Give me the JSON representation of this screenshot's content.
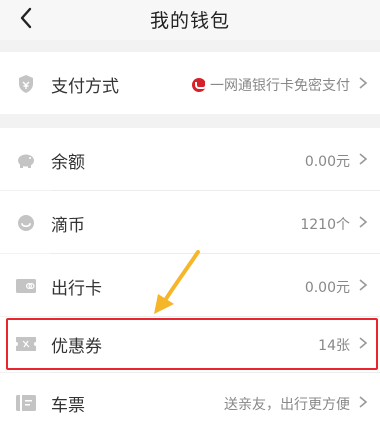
{
  "header": {
    "title": "我的钱包",
    "back_icon": "chevron-left-icon"
  },
  "rows": [
    {
      "icon": "shield-icon",
      "label": "支付方式",
      "value": "一网通银行卡免密支付",
      "badge": "cmb-logo-icon"
    },
    {
      "icon": "piggy-bank-icon",
      "label": "余额",
      "value": "0.00元"
    },
    {
      "icon": "coin-icon",
      "label": "滴币",
      "value": "1210个"
    },
    {
      "icon": "card-icon",
      "label": "出行卡",
      "value": "0.00元"
    },
    {
      "icon": "coupon-icon",
      "label": "优惠券",
      "value": "14张"
    },
    {
      "icon": "ticket-icon",
      "label": "车票",
      "value": "送亲友，出行更方便"
    }
  ],
  "colors": {
    "highlight": "#e8262d",
    "arrow": "#f5b62a",
    "icon": "#bfbfbf"
  }
}
